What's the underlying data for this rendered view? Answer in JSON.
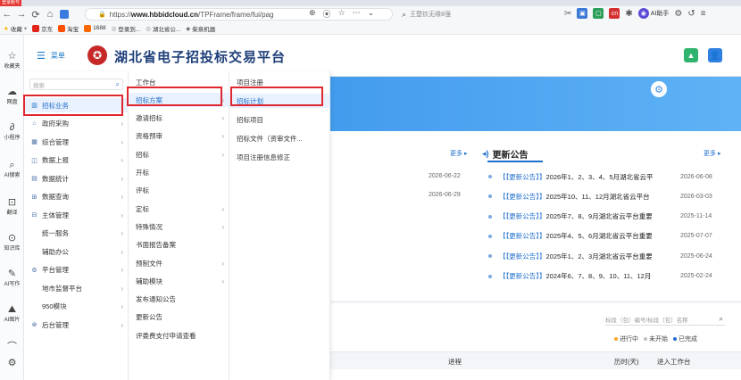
{
  "browser": {
    "login_badge": "登录账号",
    "url_prefix": "https://",
    "url_host": "www.hbbidcloud.cn",
    "url_path": "/TPFrame/frame/fui/pag",
    "search_text": "王楚钦无缘8强",
    "ai_helper": "AI助手",
    "bookmarks": [
      "收藏",
      "京东",
      "淘宝",
      "1688",
      "登录到...",
      "湖北省公...",
      "柴泉机器"
    ]
  },
  "rail": [
    {
      "label": "收藏夹",
      "icon": "star-icon"
    },
    {
      "label": "网盘",
      "icon": "cloud-drive-icon"
    },
    {
      "label": "小程序",
      "icon": "mini-program-icon"
    },
    {
      "label": "AI搜索",
      "icon": "ai-search-icon"
    },
    {
      "label": "翻译",
      "icon": "translate-icon"
    },
    {
      "label": "知识库",
      "icon": "knowledge-base-icon"
    },
    {
      "label": "AI写作",
      "icon": "ai-writing-icon"
    },
    {
      "label": "AI图片",
      "icon": "ai-image-icon"
    }
  ],
  "header": {
    "menu_label": "菜单",
    "title": "湖北省电子招投标交易平台"
  },
  "menu": {
    "search_placeholder": "搜索",
    "col1": [
      {
        "label": "招标业务",
        "active": true
      },
      {
        "label": "政府采购"
      },
      {
        "label": "综合管理"
      },
      {
        "label": "数据上报"
      },
      {
        "label": "数据统计"
      },
      {
        "label": "数据查询"
      },
      {
        "label": "主体管理"
      },
      {
        "label": "统一服务",
        "sub": true
      },
      {
        "label": "辅助办公",
        "sub": true
      },
      {
        "label": "平台管理"
      },
      {
        "label": "地市监督平台",
        "sub": true
      },
      {
        "label": "950模块",
        "sub": true
      },
      {
        "label": "后台管理"
      }
    ],
    "col2": [
      {
        "label": "工作台"
      },
      {
        "label": "招标方案",
        "active": true
      },
      {
        "label": "邀请招标"
      },
      {
        "label": "资格预审"
      },
      {
        "label": "招标"
      },
      {
        "label": "开标"
      },
      {
        "label": "评标"
      },
      {
        "label": "定标"
      },
      {
        "label": "特殊情况"
      },
      {
        "label": "书面报告备案"
      },
      {
        "label": "预制文件"
      },
      {
        "label": "辅助模块"
      },
      {
        "label": "发布通知公告"
      },
      {
        "label": "更新公告"
      },
      {
        "label": "评委费支付申请查看"
      }
    ],
    "col3": [
      {
        "label": "项目注册"
      },
      {
        "label": "招标计划",
        "active": true
      },
      {
        "label": "招标项目"
      },
      {
        "label": "招标文件（资审文件..."
      },
      {
        "label": "项目注册信息修正"
      }
    ]
  },
  "news": {
    "more_label": "更多",
    "section_title": "更新公告",
    "left_dates": [
      "2026-06-22",
      "2026-06-29"
    ],
    "items": [
      {
        "tag": "【【更新公告】】",
        "title": "2026年1、2、3、4、5月湖北省云平",
        "date": "2026-06-08"
      },
      {
        "tag": "【【更新公告】】",
        "title": "2025年10、11、12月湖北省云平台",
        "date": "2026-03-03"
      },
      {
        "tag": "【【更新公告】】",
        "title": "2025年7、8、9月湖北省云平台重要",
        "date": "2025-11-14"
      },
      {
        "tag": "【【更新公告】】",
        "title": "2025年4、5、6月湖北省云平台重要",
        "date": "2025-07-07"
      },
      {
        "tag": "【【更新公告】】",
        "title": "2025年1、2、3月湖北省云平台重要",
        "date": "2025-06-24"
      },
      {
        "tag": "【【更新公告】】",
        "title": "2024年6、7、8、9、10、11、12月",
        "date": "2025-02-24"
      }
    ]
  },
  "workbench": {
    "search_placeholder": "标段（包）编号/标段（包）名称",
    "legend": [
      {
        "label": "进行中",
        "color": "#f5a623"
      },
      {
        "label": "未开始",
        "color": "#bfbfbf"
      },
      {
        "label": "已完成",
        "color": "#1f6fcc"
      }
    ],
    "columns": [
      "进程",
      "历时(天)",
      "进入工作台"
    ]
  }
}
